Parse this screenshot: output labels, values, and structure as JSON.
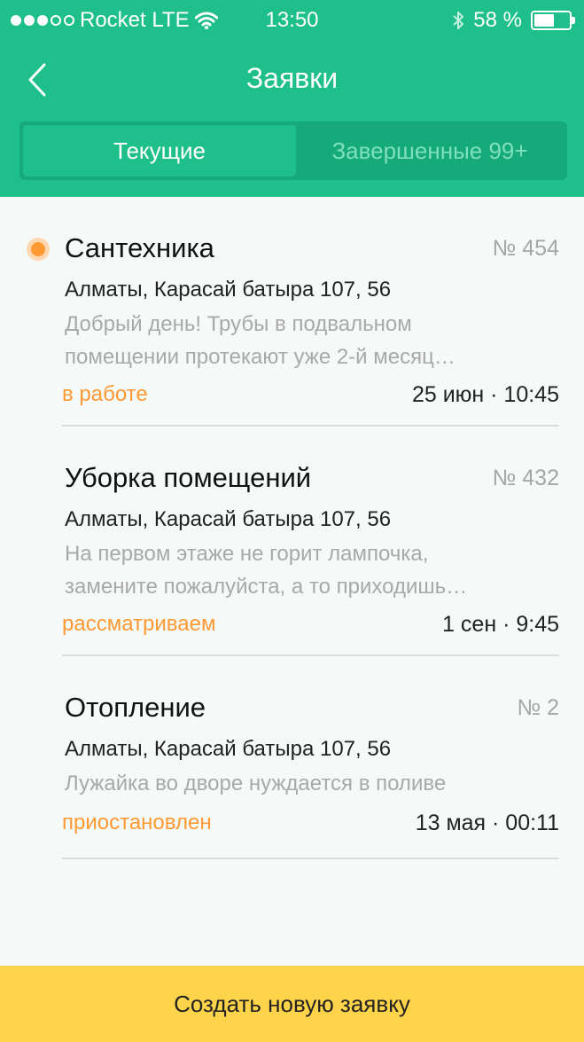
{
  "status_bar": {
    "carrier": "Rocket LTE",
    "time": "13:50",
    "battery": "58 %"
  },
  "nav": {
    "title": "Заявки"
  },
  "tabs": {
    "current": "Текущие",
    "completed": "Завершенные 99+"
  },
  "requests": [
    {
      "title": "Сантехника",
      "number": "№ 454",
      "address": "Алматы, Карасай батыра 107, 56",
      "description_line1": "Добрый день! Трубы в подвальном",
      "description_line2": "помещении протекают уже 2-й месяц…",
      "status": "в работе",
      "date": "25 июн · 10:45",
      "unread": true
    },
    {
      "title": "Уборка помещений",
      "number": "№ 432",
      "address": "Алматы, Карасай батыра 107, 56",
      "description_line1": "На первом этаже не горит лампочка,",
      "description_line2": "замените пожалуйста, а то приходишь…",
      "status": "рассматриваем",
      "date": "1 сен · 9:45",
      "unread": false
    },
    {
      "title": "Отопление",
      "number": "№ 2",
      "address": "Алматы, Карасай батыра 107, 56",
      "description_line1": "Лужайка во дворе нуждается в поливе",
      "description_line2": "",
      "status": "приостановлен",
      "date": "13 мая · 00:11",
      "unread": false
    }
  ],
  "create_button": "Создать новую заявку",
  "colors": {
    "accent": "#1ebf8a",
    "status": "#ff9933",
    "button": "#ffd44a"
  }
}
